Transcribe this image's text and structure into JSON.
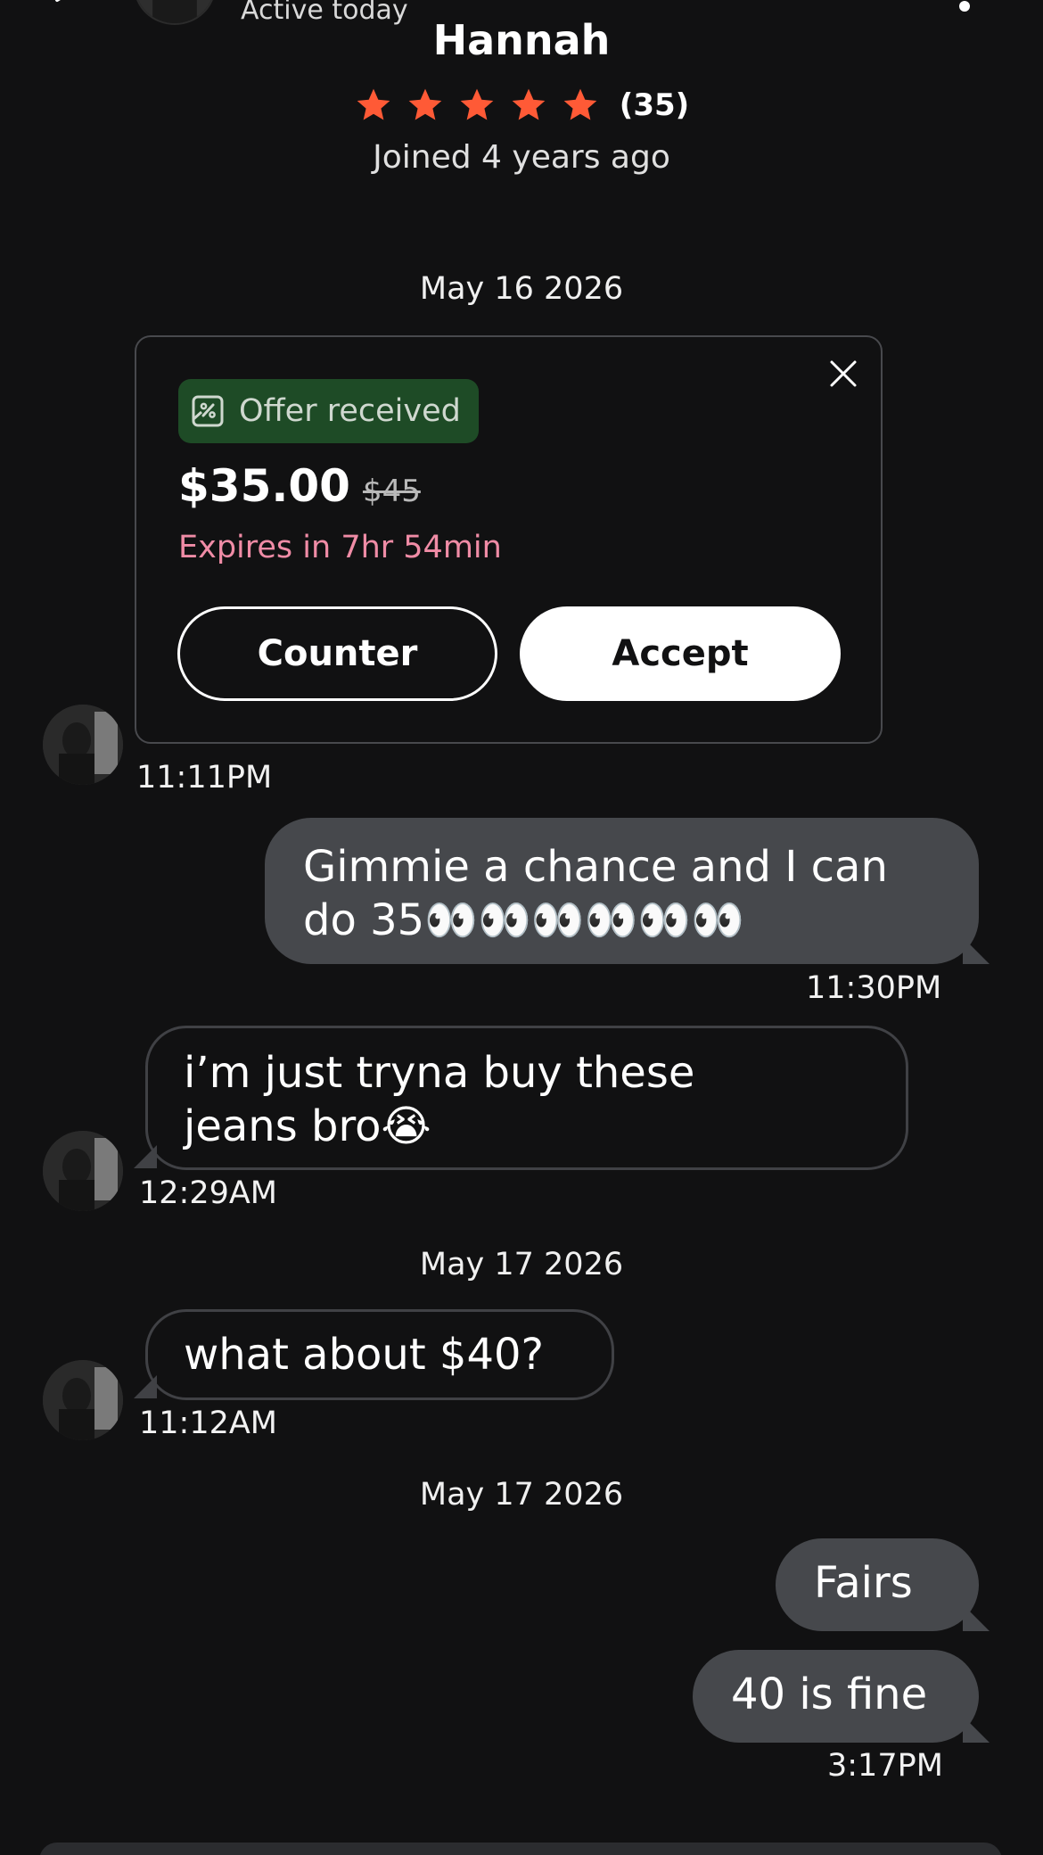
{
  "header": {
    "status": "Active today",
    "name": "Hannah",
    "rating_count": "(35)",
    "stars": 5,
    "joined": "Joined 4 years ago",
    "icons": [
      "back-icon",
      "more-icon"
    ]
  },
  "offer": {
    "badge": "Offer received",
    "price": "$35.00",
    "original_price": "$45",
    "expires": "Expires in 7hr 54min",
    "counter_label": "Counter",
    "accept_label": "Accept"
  },
  "dates": {
    "d1": "May 16 2026",
    "d2": "May 17 2026",
    "d3": "May 17 2026"
  },
  "messages": {
    "offer_time": "11:11PM",
    "m1": {
      "line1": "Gimmie a chance and I can",
      "line2": "do 35👀👀👀👀👀👀",
      "time": "11:30PM"
    },
    "m2": {
      "line1": "i’m just tryna buy these",
      "line2": "jeans bro😭",
      "time": "12:29AM"
    },
    "m3": {
      "text": "what about $40?",
      "time": "11:12AM"
    },
    "m4": {
      "text": "Fairs"
    },
    "m5": {
      "text": "40 is fine",
      "time": "3:17PM"
    }
  },
  "colors": {
    "background": "#111112",
    "star": "#ff5a36",
    "offer_badge": "#1e4b26",
    "expires": "#f08ca6",
    "outgoing_bubble": "#46484c"
  }
}
